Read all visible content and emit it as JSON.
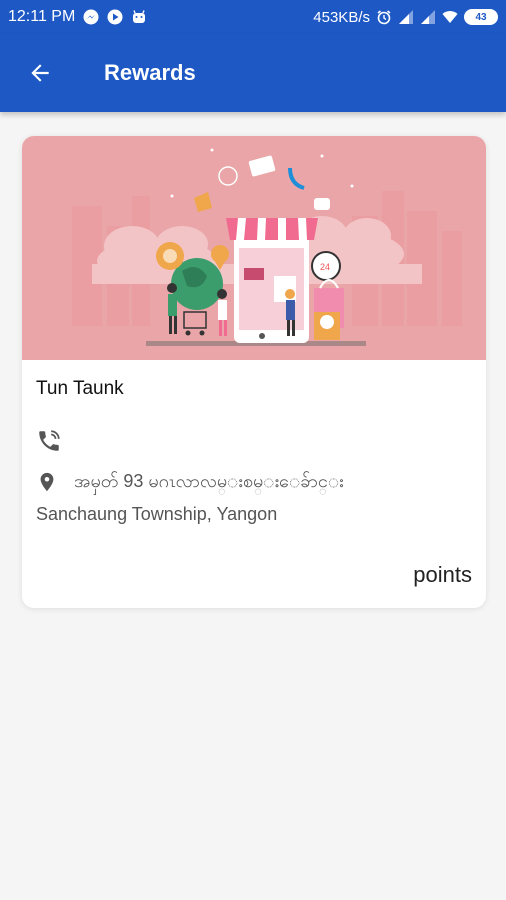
{
  "status_bar": {
    "time": "12:11 PM",
    "speed": "453KB/s",
    "battery": "43",
    "icons": [
      "messenger-icon",
      "play-icon",
      "android-icon",
      "alarm-icon",
      "signal-icon",
      "signal-icon",
      "wifi-icon",
      "battery-icon"
    ]
  },
  "appbar": {
    "title": "Rewards",
    "back_icon": "arrow-left-icon"
  },
  "card": {
    "name": "Tun Taunk",
    "phone_icon": "phone-icon",
    "address_icon": "location-pin-icon",
    "address_line1": "အမှတ် 93 မဂၤလာလမ္းစမ္းေခ်ာင္း",
    "address_line2": "Sanchaung Township, Yangon",
    "points_label": "points"
  },
  "colors": {
    "primary": "#1d58c5",
    "hero_bg": "#e9a5a7",
    "card_bg": "#ffffff",
    "page_bg": "#f5f5f5"
  }
}
